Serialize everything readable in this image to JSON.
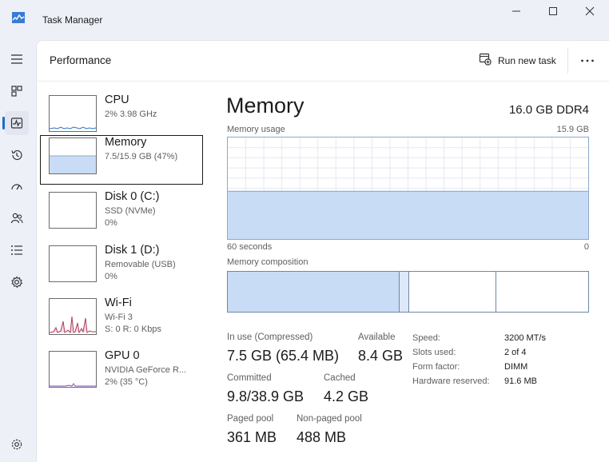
{
  "window": {
    "title": "Task Manager"
  },
  "header": {
    "title": "Performance",
    "run_new_task": "Run new task"
  },
  "rail": {
    "items": [
      "menu-icon",
      "processes-icon",
      "performance-icon",
      "app-history-icon",
      "startup-apps-icon",
      "users-icon",
      "details-icon",
      "services-icon"
    ],
    "active": "performance-icon",
    "bottom": "settings-icon"
  },
  "devices": [
    {
      "name": "CPU",
      "sub1": "2%  3.98 GHz",
      "sub2": ""
    },
    {
      "name": "Memory",
      "sub1": "7.5/15.9 GB (47%)",
      "sub2": "",
      "selected": true
    },
    {
      "name": "Disk 0 (C:)",
      "sub1": "SSD (NVMe)",
      "sub2": "0%"
    },
    {
      "name": "Disk 1 (D:)",
      "sub1": "Removable (USB)",
      "sub2": "0%"
    },
    {
      "name": "Wi-Fi",
      "sub1": "Wi-Fi 3",
      "sub2": "S: 0  R: 0 Kbps"
    },
    {
      "name": "GPU 0",
      "sub1": "NVIDIA GeForce R...",
      "sub2": "2%  (35 °C)"
    }
  ],
  "detail": {
    "title": "Memory",
    "spec": "16.0 GB DDR4",
    "usage_label": "Memory usage",
    "usage_max": "15.9 GB",
    "time_left": "60 seconds",
    "time_right": "0",
    "usage_fraction": 0.47,
    "composition_label": "Memory composition",
    "stats": {
      "in_use_label": "In use (Compressed)",
      "in_use_value": "7.5 GB (65.4 MB)",
      "available_label": "Available",
      "available_value": "8.4 GB",
      "committed_label": "Committed",
      "committed_value": "9.8/38.9 GB",
      "cached_label": "Cached",
      "cached_value": "4.2 GB",
      "paged_label": "Paged pool",
      "paged_value": "361 MB",
      "nonpaged_label": "Non-paged pool",
      "nonpaged_value": "488 MB"
    },
    "kv": [
      {
        "label": "Speed:",
        "value": "3200 MT/s"
      },
      {
        "label": "Slots used:",
        "value": "2 of 4"
      },
      {
        "label": "Form factor:",
        "value": "DIMM"
      },
      {
        "label": "Hardware reserved:",
        "value": "91.6 MB"
      }
    ]
  },
  "colors": {
    "accent": "#2068c8",
    "memory_fill": "#c9dcf6",
    "memory_line": "#8fa8cc",
    "wifi_line": "#b33a5a"
  }
}
